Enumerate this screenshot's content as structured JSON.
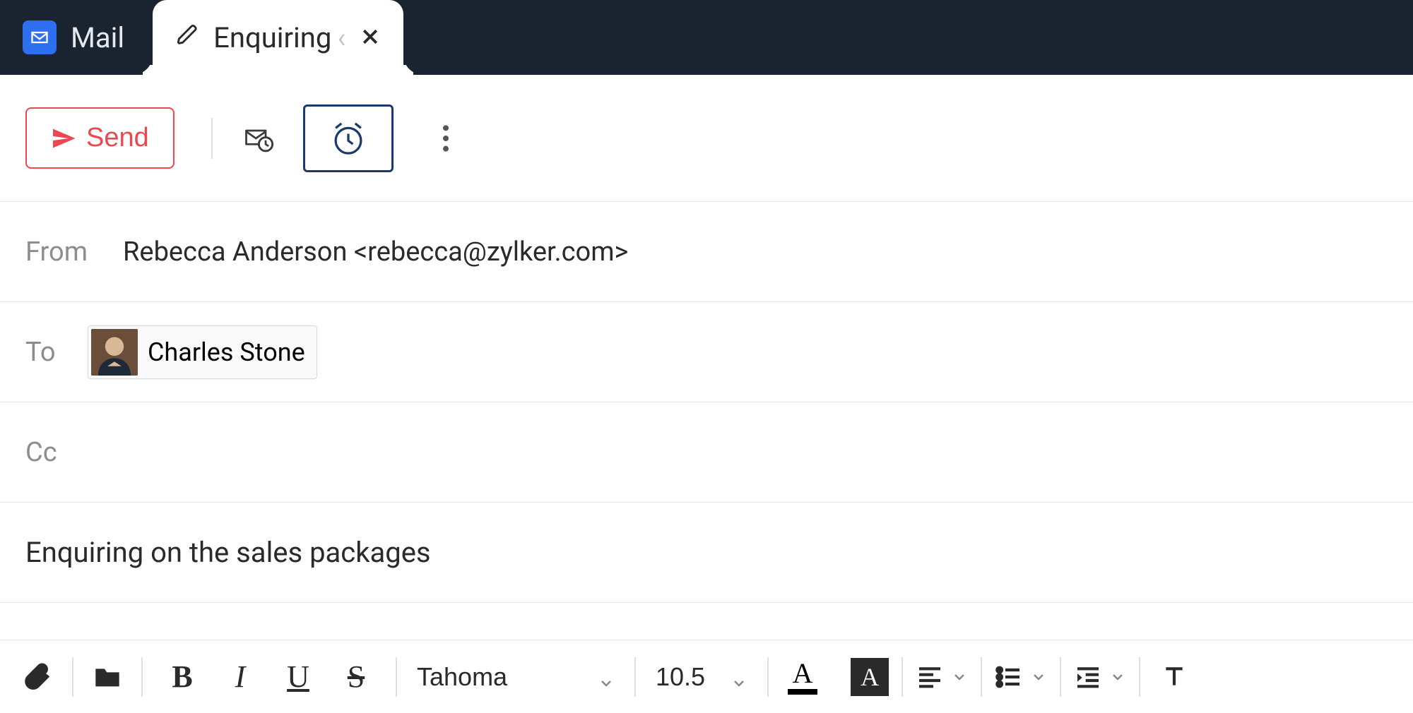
{
  "tabs": {
    "mail_label": "Mail",
    "compose_label": "Enquiring"
  },
  "toolbar": {
    "send_label": "Send"
  },
  "compose": {
    "from_label": "From",
    "from_value": "Rebecca Anderson <rebecca@zylker.com>",
    "to_label": "To",
    "to_chip_name": "Charles Stone",
    "cc_label": "Cc",
    "subject": "Enquiring on the sales packages"
  },
  "format": {
    "font_name": "Tahoma",
    "font_size": "10.5",
    "bold": "B",
    "italic": "I",
    "underline": "U",
    "strike": "S",
    "color_letter": "A",
    "bgcolor_letter": "A"
  }
}
